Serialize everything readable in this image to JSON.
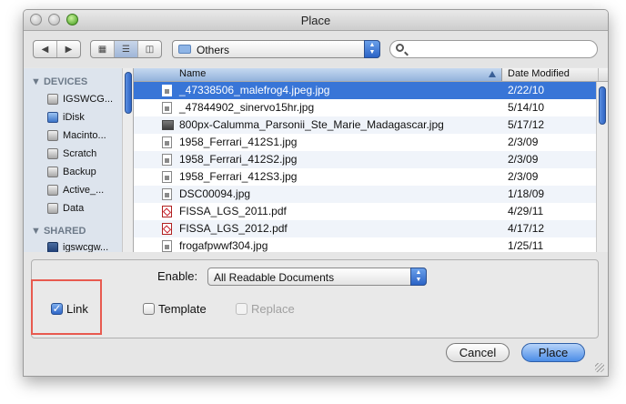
{
  "window": {
    "title": "Place"
  },
  "toolbar": {
    "back_icon": "back-arrow-icon",
    "forward_icon": "forward-arrow-icon",
    "view_icons": [
      "icon-view-icon",
      "list-view-icon",
      "column-view-icon"
    ],
    "location": "Others",
    "search_value": ""
  },
  "sidebar": {
    "devices_header": "DEVICES",
    "devices": [
      "IGSWCG...",
      "iDisk",
      "Macinto...",
      "Scratch",
      "Backup",
      "Active_...",
      "Data"
    ],
    "shared_header": "SHARED",
    "shared": [
      "igswcgw..."
    ]
  },
  "files": {
    "col_name": "Name",
    "col_date": "Date Modified",
    "rows": [
      {
        "name": "_47338506_malefrog4.jpeg.jpg",
        "date": "2/22/10"
      },
      {
        "name": "_47844902_sinervo15hr.jpg",
        "date": "5/14/10"
      },
      {
        "name": "800px-Calumma_Parsonii_Ste_Marie_Madagascar.jpg",
        "date": "5/17/12"
      },
      {
        "name": "1958_Ferrari_412S1.jpg",
        "date": "2/3/09"
      },
      {
        "name": "1958_Ferrari_412S2.jpg",
        "date": "2/3/09"
      },
      {
        "name": "1958_Ferrari_412S3.jpg",
        "date": "2/3/09"
      },
      {
        "name": "DSC00094.jpg",
        "date": "1/18/09"
      },
      {
        "name": "FISSA_LGS_2011.pdf",
        "date": "4/29/11"
      },
      {
        "name": "FISSA_LGS_2012.pdf",
        "date": "4/17/12"
      },
      {
        "name": "frogafpwwf304.jpg",
        "date": "1/25/11"
      }
    ]
  },
  "options": {
    "enable_label": "Enable:",
    "enable_value": "All Readable Documents",
    "link_label": "Link",
    "template_label": "Template",
    "replace_label": "Replace"
  },
  "buttons": {
    "cancel": "Cancel",
    "place": "Place"
  },
  "colors": {
    "selection": "#3875d7",
    "highlight": "#e85a4f"
  }
}
